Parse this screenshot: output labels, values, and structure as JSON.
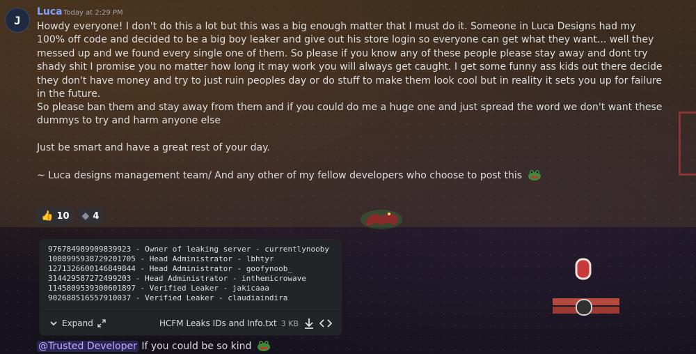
{
  "message": {
    "username": "Luca",
    "timestamp": "Today at 2:29 PM",
    "paragraphs": [
      "Howdy everyone! I don't do this a lot but this was a big enough matter that I must do it. Someone in Luca Designs had my 100% off code and decided to be a big boy leaker and give out his store login so everyone can get what they want... well they messed up and we found every single one of them. So please if you know any of these people please stay away and dont try shady shit I promise you no matter how long it may work you will always get caught. I get some funny ass kids out there decide they don't have money and try to just ruin peoples day or do stuff to make them look cool but in reality it sets you up for failure in the future.",
      "So please ban them and stay away from them and if you could do me a huge one and just spread the word we don't want these dummys to try and harm anyone else",
      "Just be smart and have a great rest of your day.",
      "~ Luca designs management team/ And any other of my fellow developers who choose to post this"
    ],
    "emoji_name": "frog-emoji",
    "reactions": [
      {
        "icon": "thumbs-up-icon",
        "glyph": "👍",
        "count": "10"
      },
      {
        "icon": "custom-emoji-icon",
        "glyph": "◆",
        "count": "4"
      }
    ],
    "sticker_name": "dragon-sticker"
  },
  "attachment": {
    "lines": [
      "976784989909839923 - Owner of leaking server - currentlynooby",
      "1008995938729201705 - Head Administrator - lbhtyr",
      "1271326600146849844 - Head Administrator - goofynoob_",
      "314429587272499203 - Head Administrator - inthemicrowave",
      "1145809539300601897 - Verified Leaker - jakicaaa",
      "902688516557910037 - Verified Leaker - claudiaindira"
    ],
    "expand_label": "Expand",
    "filename": "HCFM Leaks IDs and Info.txt",
    "filesize": "3 KB"
  },
  "next_message": {
    "mention": "@Trusted Developer",
    "text": "If you could be so kind"
  },
  "colors": {
    "username": "#7aa2ff",
    "mention": "#c9a6ff",
    "highlight": "#5f4b2d"
  }
}
